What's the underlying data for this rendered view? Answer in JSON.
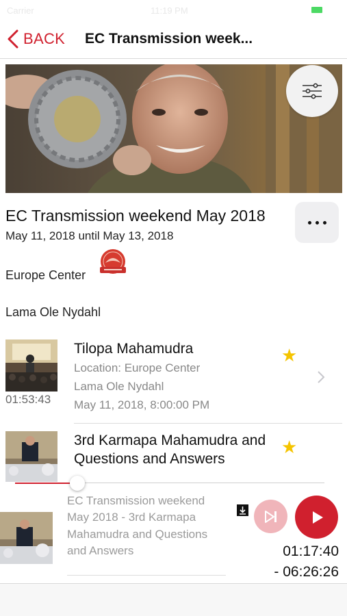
{
  "status_bar": {
    "carrier": "Carrier",
    "time": "11:19 PM"
  },
  "nav": {
    "back_label": "BACK",
    "title": "EC Transmission week..."
  },
  "event": {
    "title": "EC Transmission weekend May 2018",
    "dates": "May 11, 2018 until May 13, 2018",
    "center": "Europe Center",
    "teacher": "Lama Ole Nydahl"
  },
  "talks": [
    {
      "title": "Tilopa Mahamudra",
      "location": "Location: Europe Center",
      "teacher": "Lama Ole Nydahl",
      "date": "May 11, 2018, 8:00:00 PM",
      "duration": "01:53:43",
      "starred": true
    },
    {
      "title": "3rd Karmapa Mahamudra and Questions and Answers",
      "starred": true
    }
  ],
  "player": {
    "now_playing": "EC Transmission weekend May 2018 - 3rd Karmapa Mahamudra and Questions and Answers",
    "elapsed": "01:17:40",
    "remaining": "- 06:26:26",
    "progress_fraction": 0.2
  },
  "icons": {
    "back": "chevron-left-icon",
    "filter": "sliders-icon",
    "more": "ellipsis-icon",
    "star": "star-icon",
    "chevron": "chevron-right-icon",
    "download": "download-icon",
    "next": "skip-next-icon",
    "play": "play-icon"
  },
  "colors": {
    "accent": "#d0202e",
    "star": "#f5c400",
    "next_button": "#f0b5ba"
  }
}
